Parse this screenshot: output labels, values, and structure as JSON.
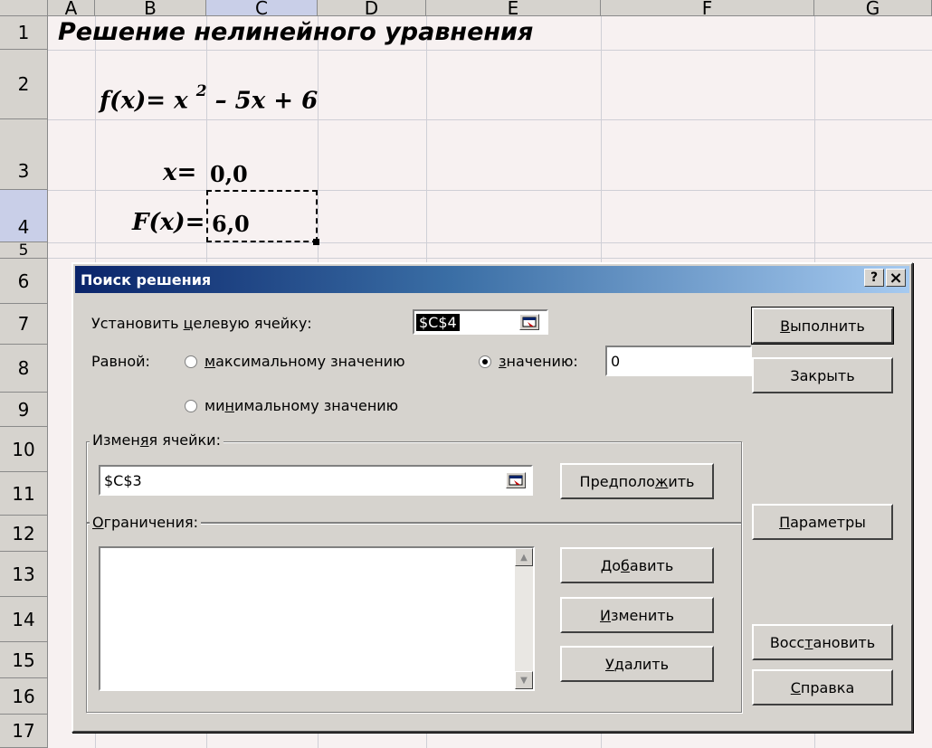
{
  "sheet": {
    "columns": [
      "A",
      "B",
      "C",
      "D",
      "E",
      "F",
      "G"
    ],
    "rows": [
      "1",
      "2",
      "3",
      "4",
      "5",
      "6",
      "7",
      "8",
      "9",
      "10",
      "11",
      "12",
      "13",
      "14",
      "15",
      "16",
      "17"
    ],
    "title": "Решение нелинейного уравнения",
    "formula": {
      "lhs": "f(x)= x ",
      "exp": "2",
      "rhs": " – 5x + 6"
    },
    "x_label": "x=",
    "x_value": "0,0",
    "fx_label": "F(x)=",
    "fx_value": "6,0"
  },
  "dialog": {
    "title": "Поиск решения",
    "help_btn": "?",
    "close_btn": "×",
    "target_label_pre": "Установить ",
    "target_label_ul": "ц",
    "target_label_post": "елевую ячейку:",
    "target_value": "$C$4",
    "equal_label": "Равной:",
    "radio_max_ul": "м",
    "radio_max_post": "аксимальному значению",
    "radio_value_ul": "з",
    "radio_value_post": "начению:",
    "value_input": "0",
    "radio_min_pre": "ми",
    "radio_min_ul": "н",
    "radio_min_post": "имальному значению",
    "changing_pre": "Измен",
    "changing_ul": "я",
    "changing_post": "я ячейки:",
    "changing_value": "$C$3",
    "guess_pre": "Предполо",
    "guess_ul": "ж",
    "guess_post": "ить",
    "constraints_ul": "О",
    "constraints_post": "граничения:",
    "add_pre": "До",
    "add_ul": "б",
    "add_post": "авить",
    "edit_ul": "И",
    "edit_post": "зменить",
    "delete_ul": "У",
    "delete_post": "далить",
    "solve_ul": "В",
    "solve_post": "ыполнить",
    "close_label": "Закрыть",
    "options_ul": "П",
    "options_post": "араметры",
    "reset_pre": "Восс",
    "reset_ul": "т",
    "reset_post": "ановить",
    "help_ul": "С",
    "help_post": "правка"
  }
}
